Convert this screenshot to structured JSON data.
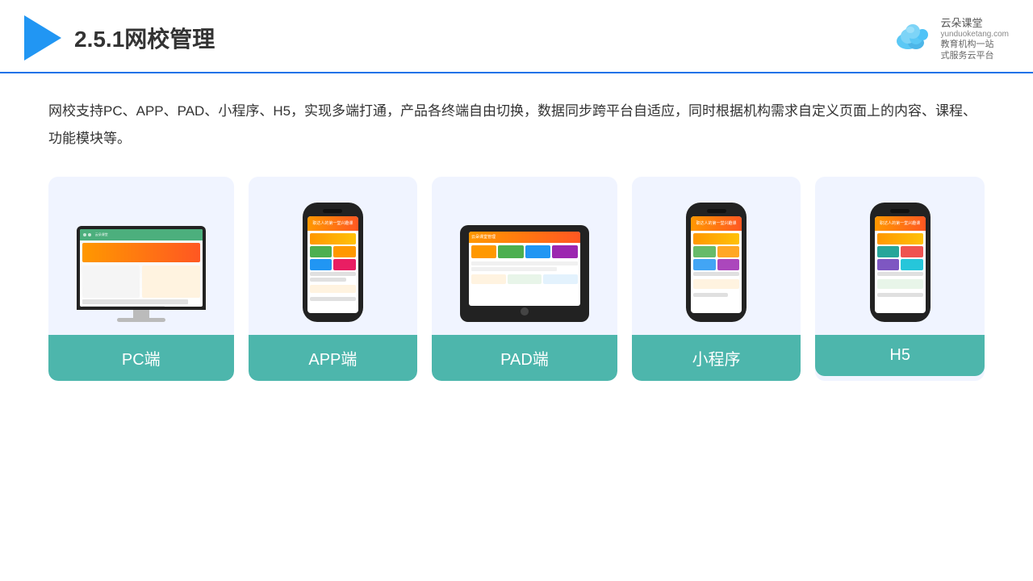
{
  "header": {
    "slide_number": "2.5.1",
    "title": "网校管理",
    "brand_name": "云朵课堂",
    "brand_url": "yunduoketang.com",
    "brand_tagline": "教育机构一站\n式服务云平台"
  },
  "description": "网校支持PC、APP、PAD、小程序、H5，实现多端打通，产品各终端自由切换，数据同步跨平台自适应，同时根据机构需求自定义页面上的内容、课程、功能模块等。",
  "cards": [
    {
      "id": "pc",
      "label": "PC端"
    },
    {
      "id": "app",
      "label": "APP端"
    },
    {
      "id": "pad",
      "label": "PAD端"
    },
    {
      "id": "miniprogram",
      "label": "小程序"
    },
    {
      "id": "h5",
      "label": "H5"
    }
  ]
}
